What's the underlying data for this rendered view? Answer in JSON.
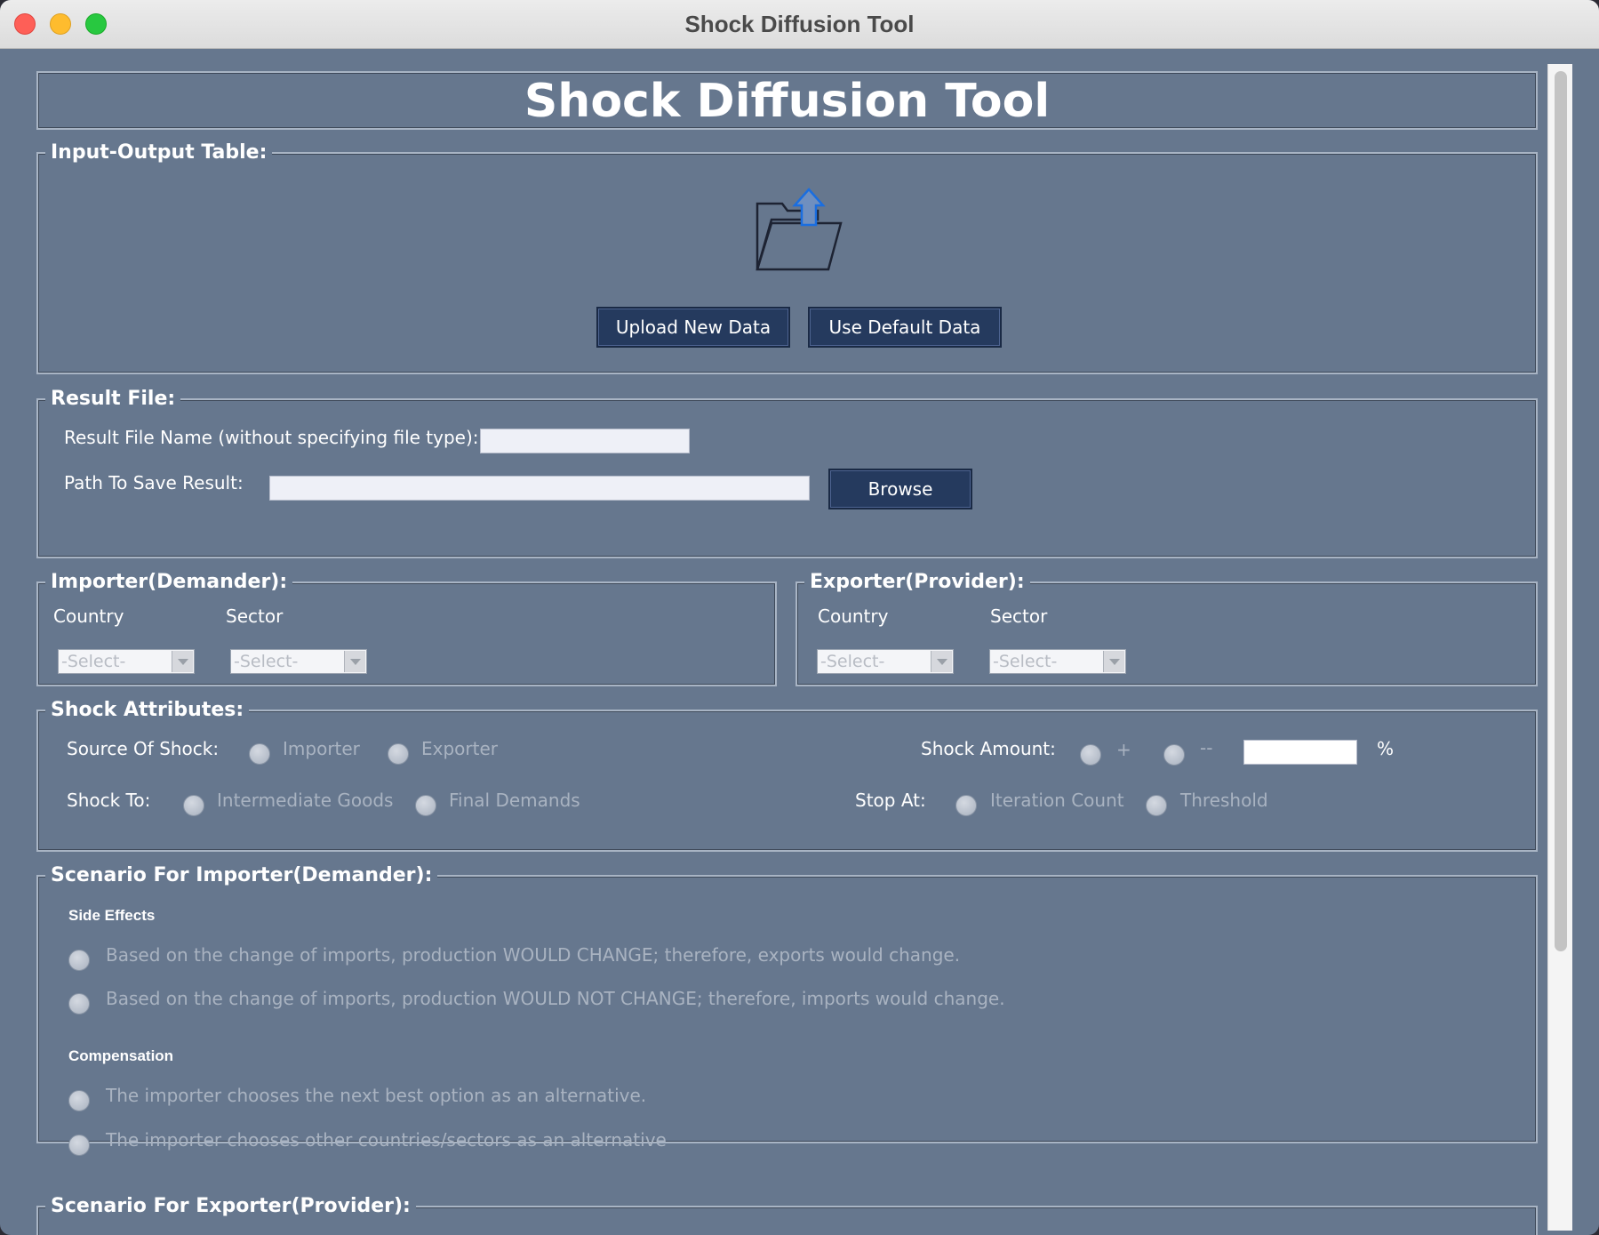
{
  "window": {
    "title": "Shock Diffusion Tool"
  },
  "header": {
    "title": "Shock Diffusion Tool"
  },
  "io_table": {
    "legend": "Input-Output Table:",
    "upload_label": "Upload New Data",
    "default_label": "Use Default Data"
  },
  "result_file": {
    "legend": "Result File:",
    "name_label": "Result File Name (without specifying file type):",
    "name_value": "",
    "path_label": "Path To Save Result:",
    "path_value": "",
    "browse_label": "Browse"
  },
  "importer": {
    "legend": "Importer(Demander):",
    "country_label": "Country",
    "sector_label": "Sector",
    "country_value": "-Select-",
    "sector_value": "-Select-"
  },
  "exporter": {
    "legend": "Exporter(Provider):",
    "country_label": "Country",
    "sector_label": "Sector",
    "country_value": "-Select-",
    "sector_value": "-Select-"
  },
  "shock": {
    "legend": "Shock Attributes:",
    "source_label": "Source Of Shock:",
    "source_importer": "Importer",
    "source_exporter": "Exporter",
    "amount_label": "Shock Amount:",
    "plus": "+",
    "minus": "--",
    "amount_value": "",
    "percent": "%",
    "to_label": "Shock To:",
    "to_intermediate": "Intermediate Goods",
    "to_final": "Final Demands",
    "stop_label": "Stop At:",
    "stop_iteration": "Iteration Count",
    "stop_threshold": "Threshold"
  },
  "scenario_importer": {
    "legend": "Scenario For Importer(Demander):",
    "side_effects_label": "Side Effects",
    "side_option_1": "Based on the change of imports, production WOULD CHANGE; therefore, exports would change.",
    "side_option_2": "Based on the change of imports, production WOULD NOT CHANGE; therefore, imports would change.",
    "compensation_label": "Compensation",
    "comp_option_1": "The importer chooses the next best option as an alternative.",
    "comp_option_2": "The importer chooses other countries/sectors as an alternative"
  },
  "scenario_exporter": {
    "legend": "Scenario For Exporter(Provider):"
  },
  "icons": {
    "upload": "folder-upload-icon"
  }
}
